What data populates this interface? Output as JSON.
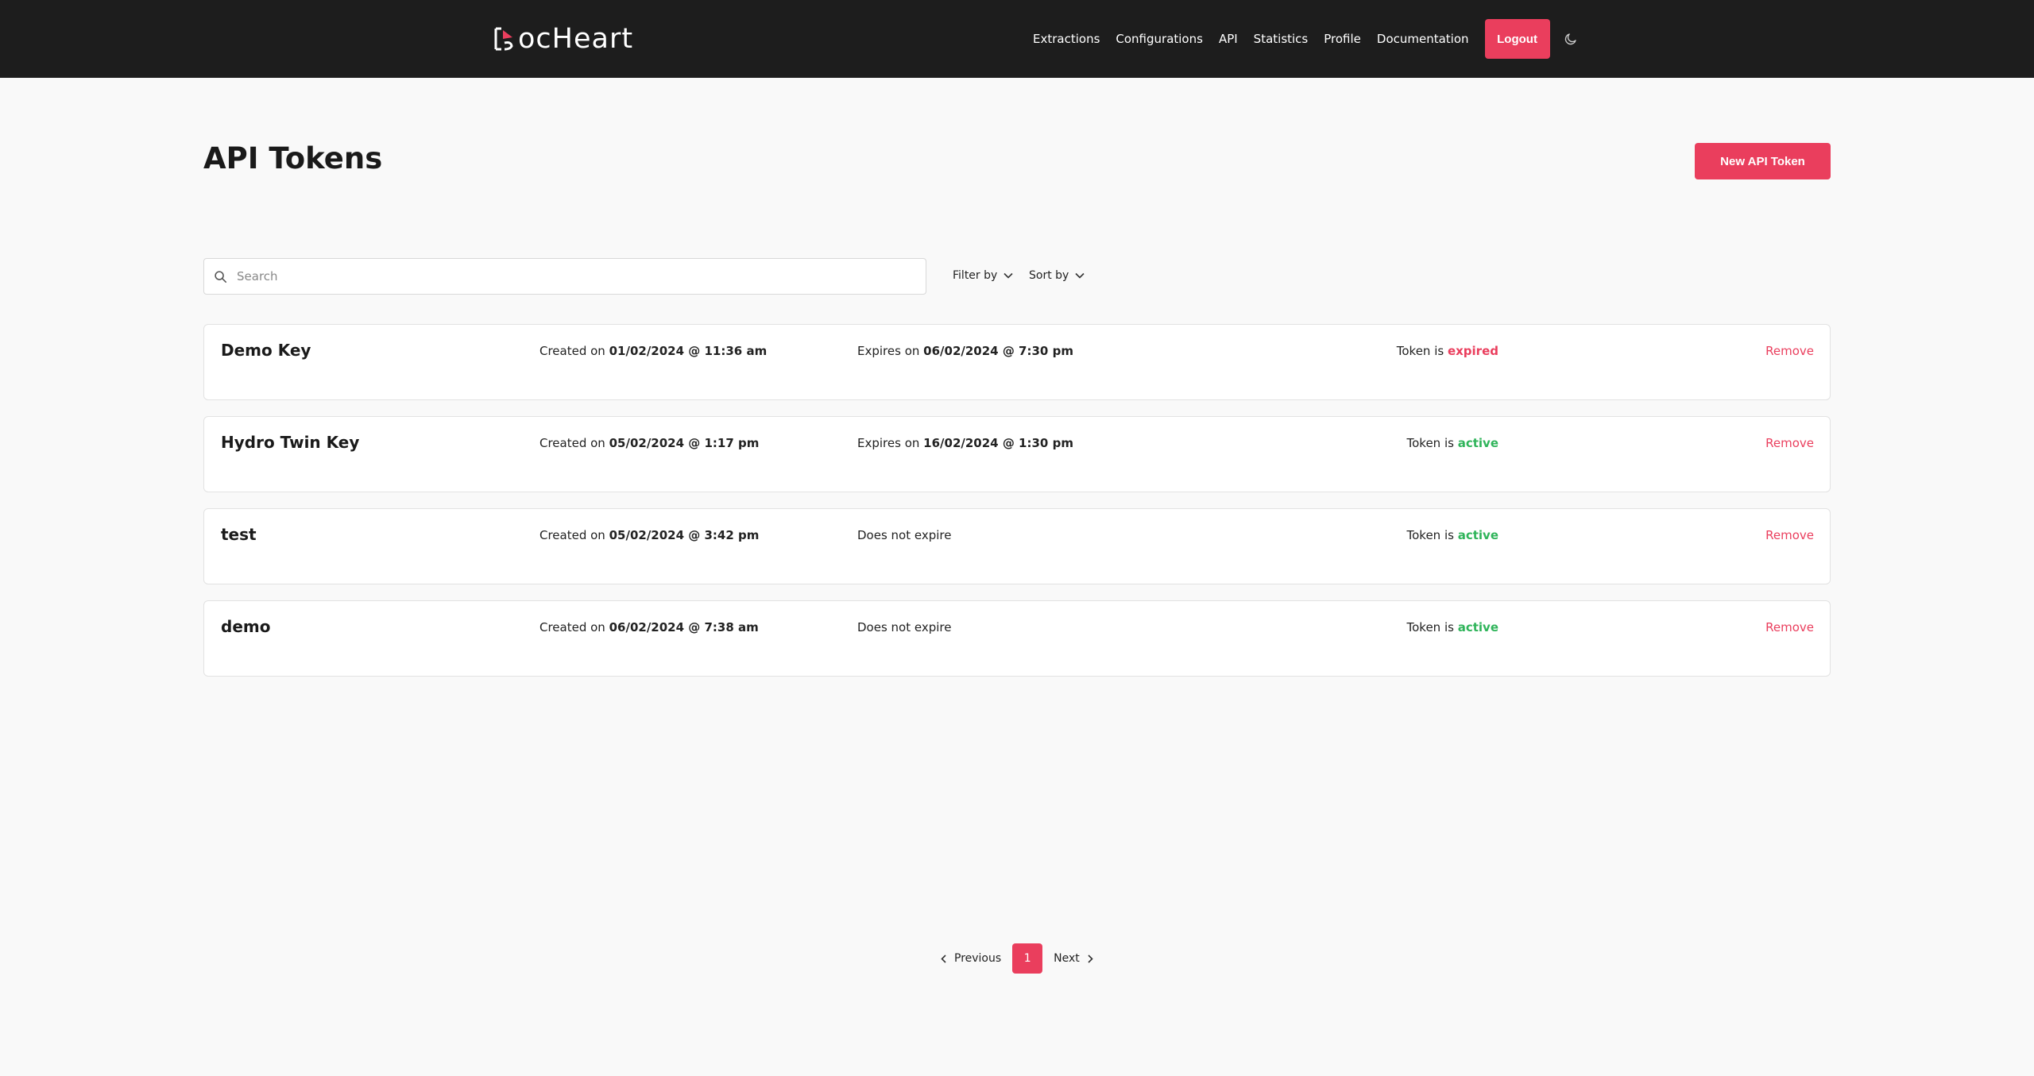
{
  "brand": {
    "name": "ocHeart",
    "accent": "#ea3e5d"
  },
  "nav": {
    "links": [
      "Extractions",
      "Configurations",
      "API",
      "Statistics",
      "Profile",
      "Documentation"
    ],
    "logout_label": "Logout",
    "theme_icon": "moon-icon"
  },
  "page": {
    "title": "API Tokens",
    "new_button_label": "New API Token"
  },
  "toolbar": {
    "search_placeholder": "Search",
    "filter_label": "Filter by",
    "sort_label": "Sort by"
  },
  "tokens": [
    {
      "name": "Demo Key",
      "created_prefix": "Created on ",
      "created": "01/02/2024 @ 11:36 am",
      "expires_prefix": "Expires on ",
      "expires": "06/02/2024 @ 7:30 pm",
      "status_prefix": "Token is ",
      "status": "expired",
      "remove_label": "Remove"
    },
    {
      "name": "Hydro Twin Key",
      "created_prefix": "Created on ",
      "created": "05/02/2024 @ 1:17 pm",
      "expires_prefix": "Expires on ",
      "expires": "16/02/2024 @ 1:30 pm",
      "status_prefix": "Token is ",
      "status": "active",
      "remove_label": "Remove"
    },
    {
      "name": "test",
      "created_prefix": "Created on ",
      "created": "05/02/2024 @ 3:42 pm",
      "expires_prefix": "",
      "expires": "Does not expire",
      "status_prefix": "Token is ",
      "status": "active",
      "remove_label": "Remove"
    },
    {
      "name": "demo",
      "created_prefix": "Created on ",
      "created": "06/02/2024 @ 7:38 am",
      "expires_prefix": "",
      "expires": "Does not expire",
      "status_prefix": "Token is ",
      "status": "active",
      "remove_label": "Remove"
    }
  ],
  "pagination": {
    "previous_label": "Previous",
    "current_page": "1",
    "next_label": "Next"
  }
}
